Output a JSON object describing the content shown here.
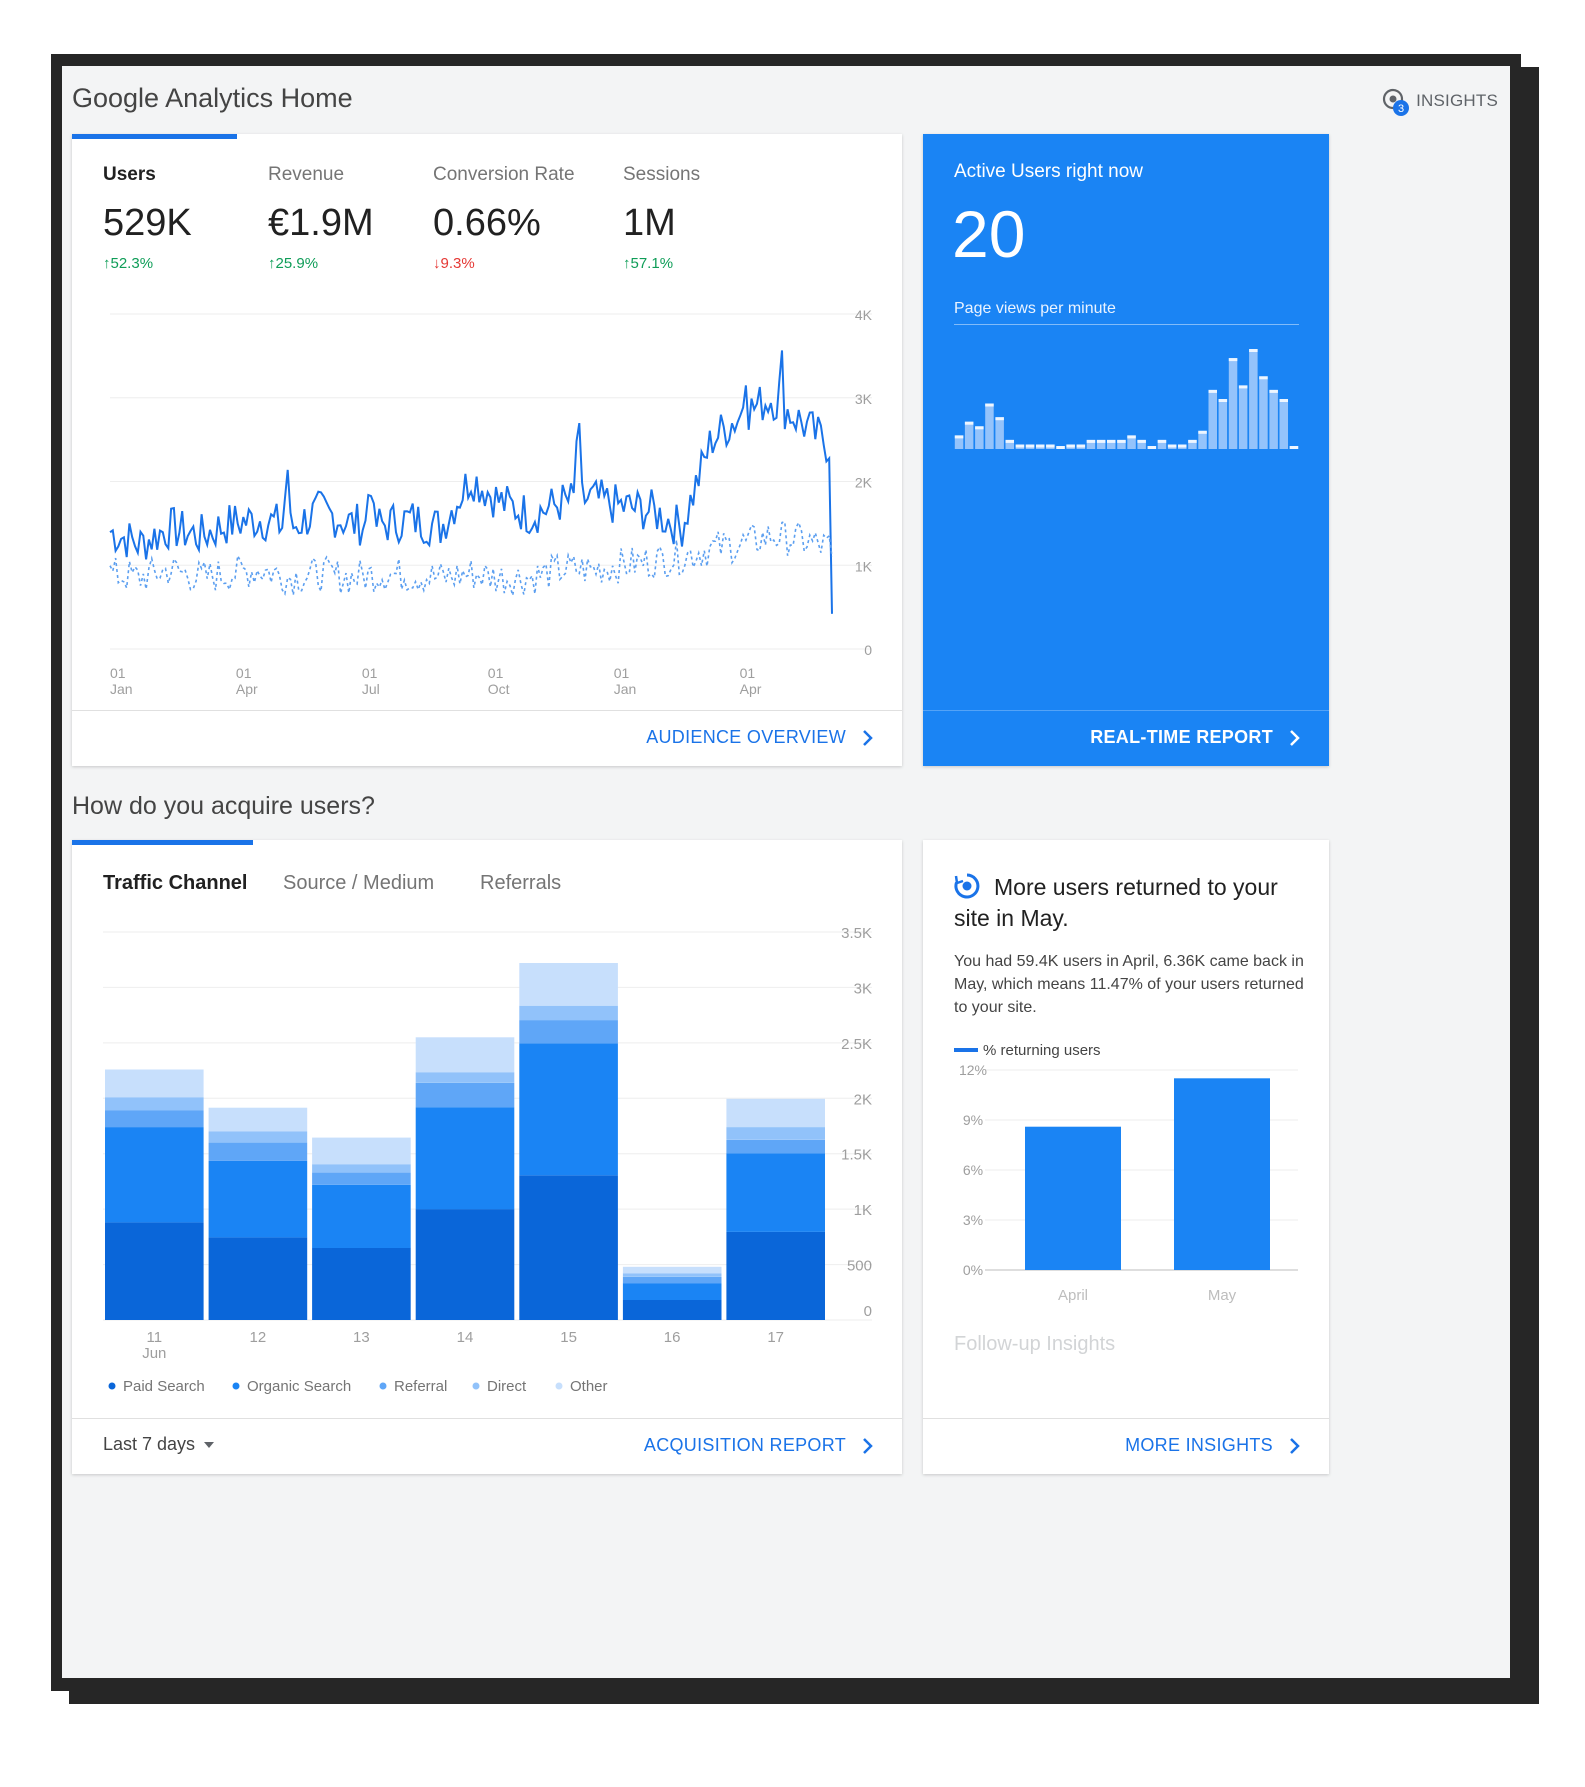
{
  "header": {
    "title": "Google Analytics Home",
    "insights_label": "INSIGHTS",
    "insights_badge": "3"
  },
  "audience": {
    "metrics": [
      {
        "label": "Users",
        "value": "529K",
        "change": "52.3%",
        "direction": "up"
      },
      {
        "label": "Revenue",
        "value": "€1.9M",
        "change": "25.9%",
        "direction": "up"
      },
      {
        "label": "Conversion Rate",
        "value": "0.66%",
        "change": "9.3%",
        "direction": "down"
      },
      {
        "label": "Sessions",
        "value": "1M",
        "change": "57.1%",
        "direction": "up"
      }
    ],
    "footer_link": "AUDIENCE OVERVIEW"
  },
  "realtime": {
    "title": "Active Users right now",
    "count": "20",
    "subtitle": "Page views per minute",
    "footer_link": "REAL-TIME REPORT"
  },
  "acquire": {
    "section_title": "How do you acquire users?",
    "tabs": [
      "Traffic Channel",
      "Source / Medium",
      "Referrals"
    ],
    "date_range": "Last 7 days",
    "footer_link": "ACQUISITION REPORT"
  },
  "insight_card": {
    "headline": "More users returned to your site in May.",
    "body": "You had 59.4K users in April, 6.36K came back in May, which means 11.47% of your users returned to your site.",
    "followup": "Follow-up Insights",
    "footer_link": "MORE INSIGHTS"
  },
  "colors": {
    "accent": "#1a73e8",
    "realtime_bg": "#1a84f4",
    "series_paid": "#0a66d9",
    "series_organic": "#1a84f4",
    "series_referral": "#5fa6f7",
    "series_direct": "#91c2fa",
    "series_other": "#c7dffc",
    "up": "#0f9d58",
    "down": "#e53935"
  },
  "chart_data": [
    {
      "type": "line",
      "title": "",
      "x_ticks": [
        {
          "day": "01",
          "month": "Jan"
        },
        {
          "day": "01",
          "month": "Apr"
        },
        {
          "day": "01",
          "month": "Jul"
        },
        {
          "day": "01",
          "month": "Oct"
        },
        {
          "day": "01",
          "month": "Jan"
        },
        {
          "day": "01",
          "month": "Apr"
        }
      ],
      "y_ticks": [
        "0",
        "1K",
        "2K",
        "3K",
        "4K"
      ],
      "ylim": [
        0,
        4000
      ],
      "series": [
        {
          "style": "solid",
          "period_values": [
            1400,
            1250,
            1450,
            1350,
            1500,
            1550,
            1450,
            1650,
            1500,
            1480,
            1550,
            1450,
            2050,
            1750,
            1600,
            1750,
            1800,
            1700,
            1650,
            1450,
            2500,
            2800,
            3000,
            2700,
            2400
          ]
        },
        {
          "style": "dotted",
          "period_values": [
            900,
            850,
            950,
            850,
            900,
            950,
            850,
            900,
            850,
            900,
            880,
            850,
            900,
            850,
            850,
            950,
            950,
            1000,
            1050,
            1100,
            1200,
            1250,
            1350,
            1300,
            1200
          ]
        }
      ]
    },
    {
      "type": "bar",
      "title": "",
      "values": [
        3,
        6,
        5,
        10,
        7,
        2,
        1,
        1,
        1,
        1,
        0,
        1,
        1,
        2,
        2,
        2,
        2,
        3,
        2,
        0,
        2,
        1,
        1,
        2,
        4,
        13,
        11,
        20,
        14,
        22,
        16,
        13,
        11,
        0
      ]
    },
    {
      "type": "bar",
      "stacked": true,
      "title": "",
      "categories": [
        {
          "day": "11",
          "month": "Jun"
        },
        {
          "day": "12",
          "month": ""
        },
        {
          "day": "13",
          "month": ""
        },
        {
          "day": "14",
          "month": ""
        },
        {
          "day": "15",
          "month": ""
        },
        {
          "day": "16",
          "month": ""
        },
        {
          "day": "17",
          "month": ""
        }
      ],
      "y_ticks": [
        "0",
        "500",
        "1K",
        "1.5K",
        "2K",
        "2.5K",
        "3K",
        "3.5K"
      ],
      "ylim": [
        0,
        3500
      ],
      "series": [
        {
          "name": "Paid Search",
          "values": [
            880,
            745,
            650,
            1000,
            1305,
            180,
            795
          ]
        },
        {
          "name": "Organic Search",
          "values": [
            860,
            690,
            570,
            920,
            1190,
            150,
            710
          ]
        },
        {
          "name": "Referral",
          "values": [
            150,
            165,
            110,
            220,
            210,
            60,
            120
          ]
        },
        {
          "name": "Direct",
          "values": [
            120,
            100,
            75,
            95,
            130,
            30,
            115
          ]
        },
        {
          "name": "Other",
          "values": [
            250,
            215,
            240,
            315,
            385,
            60,
            255
          ]
        }
      ]
    },
    {
      "type": "bar",
      "title": "",
      "legend": "% returning users",
      "categories": [
        "April",
        "May"
      ],
      "values": [
        8.6,
        11.5
      ],
      "y_ticks": [
        "0%",
        "3%",
        "6%",
        "9%",
        "12%"
      ],
      "ylim": [
        0,
        12
      ]
    }
  ]
}
